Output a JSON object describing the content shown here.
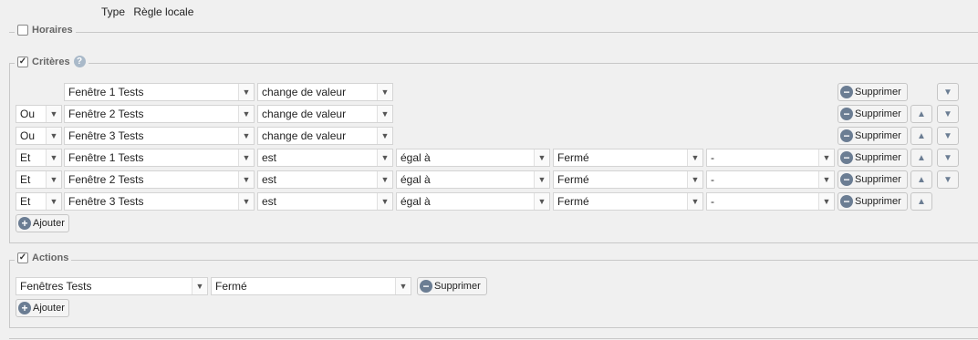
{
  "type_row": {
    "label": "Type",
    "value": "Règle locale"
  },
  "sections": {
    "horaires": {
      "label": "Horaires",
      "checked": false
    },
    "criteres": {
      "label": "Critères",
      "checked": true
    },
    "actions": {
      "label": "Actions",
      "checked": true
    }
  },
  "criteria": [
    {
      "op": "",
      "device": "Fenêtre 1 Tests",
      "cond": "change de valeur",
      "comp": "",
      "value": "",
      "extra": "",
      "up": false,
      "down": true
    },
    {
      "op": "Ou",
      "device": "Fenêtre 2 Tests",
      "cond": "change de valeur",
      "comp": "",
      "value": "",
      "extra": "",
      "up": true,
      "down": true
    },
    {
      "op": "Ou",
      "device": "Fenêtre 3 Tests",
      "cond": "change de valeur",
      "comp": "",
      "value": "",
      "extra": "",
      "up": true,
      "down": true
    },
    {
      "op": "Et",
      "device": "Fenêtre 1 Tests",
      "cond": "est",
      "comp": "égal à",
      "value": "Fermé",
      "extra": "-",
      "up": true,
      "down": true
    },
    {
      "op": "Et",
      "device": "Fenêtre 2 Tests",
      "cond": "est",
      "comp": "égal à",
      "value": "Fermé",
      "extra": "-",
      "up": true,
      "down": true
    },
    {
      "op": "Et",
      "device": "Fenêtre 3 Tests",
      "cond": "est",
      "comp": "égal à",
      "value": "Fermé",
      "extra": "-",
      "up": true,
      "down": false
    }
  ],
  "delete_label": "Supprimer",
  "add_label": "Ajouter",
  "action": {
    "device": "Fenêtres Tests",
    "value": "Fermé"
  },
  "icons": {
    "help": "help-icon",
    "arrow_up": "arrow-up-icon",
    "arrow_down": "arrow-down-icon"
  }
}
